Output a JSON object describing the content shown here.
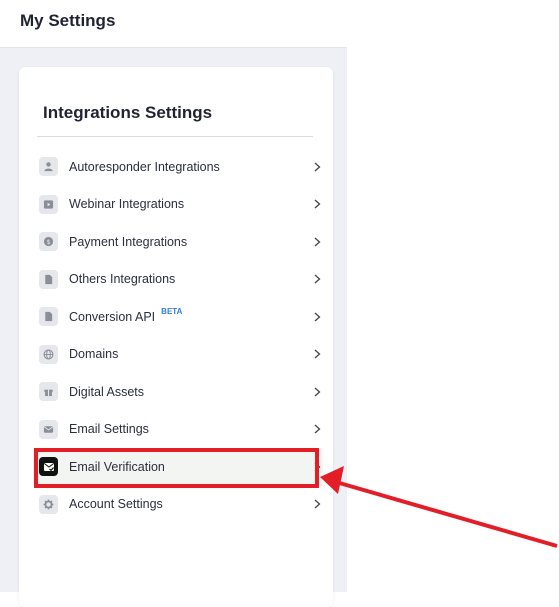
{
  "header": {
    "title": "My Settings"
  },
  "card": {
    "title": "Integrations Settings"
  },
  "menu": [
    {
      "label": "Autoresponder Integrations",
      "icon": "user-icon",
      "badge": ""
    },
    {
      "label": "Webinar Integrations",
      "icon": "play-icon",
      "badge": ""
    },
    {
      "label": "Payment Integrations",
      "icon": "dollar-icon",
      "badge": ""
    },
    {
      "label": "Others Integrations",
      "icon": "document-icon",
      "badge": ""
    },
    {
      "label": "Conversion API",
      "icon": "document-icon",
      "badge": "BETA"
    },
    {
      "label": "Domains",
      "icon": "globe-icon",
      "badge": ""
    },
    {
      "label": "Digital Assets",
      "icon": "gift-icon",
      "badge": ""
    },
    {
      "label": "Email Settings",
      "icon": "envelope-icon",
      "badge": ""
    },
    {
      "label": "Email Verification",
      "icon": "email-check-icon",
      "badge": "",
      "active": true
    },
    {
      "label": "Account Settings",
      "icon": "gear-icon",
      "badge": ""
    }
  ],
  "colors": {
    "annotation": "#e41e26",
    "beta": "#2f7de1",
    "background": "#eef0f6"
  }
}
